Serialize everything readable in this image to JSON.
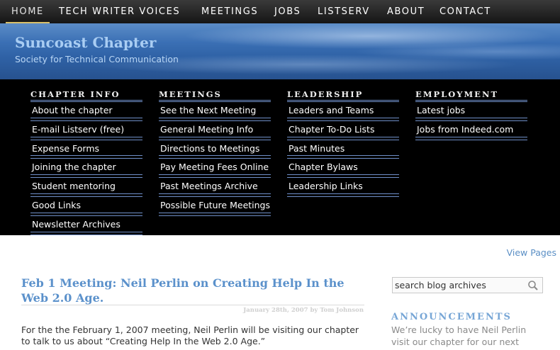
{
  "topnav": {
    "items": [
      "HOME",
      "TECH WRITER VOICES",
      "MEETINGS",
      "JOBS",
      "LISTSERV",
      "ABOUT",
      "CONTACT"
    ]
  },
  "banner": {
    "title": "Suncoast Chapter",
    "subtitle": "Society for Technical Communication"
  },
  "menu": {
    "columns": [
      {
        "heading": "CHAPTER INFO",
        "links": [
          "About the chapter",
          "E-mail Listserv (free)",
          "Expense Forms",
          "Joining the chapter",
          "Student mentoring",
          "Good Links",
          "Newsletter Archives"
        ]
      },
      {
        "heading": "MEETINGS",
        "links": [
          "See the Next Meeting",
          "General Meeting Info",
          "Directions to Meetings",
          "Pay Meeting Fees Online",
          "Past Meetings Archive",
          "Possible Future Meetings"
        ]
      },
      {
        "heading": "LEADERSHIP",
        "links": [
          "Leaders and Teams",
          "Chapter To-Do Lists",
          "Past Minutes",
          "Chapter Bylaws",
          "Leadership Links"
        ]
      },
      {
        "heading": "EMPLOYMENT",
        "links": [
          "Latest jobs",
          "Jobs from Indeed.com"
        ]
      }
    ]
  },
  "content": {
    "view_pages": "View Pages",
    "post": {
      "title": "Feb 1 Meeting: Neil Perlin on Creating Help In the Web 2.0 Age.",
      "meta": "January 28th, 2007 by Tom Johnson",
      "body_lines": [
        "For the the February 1, 2007 meeting, Neil Perlin will be visiting our chapter",
        "to talk to us about “Creating Help In the Web 2.0 Age.”"
      ]
    },
    "sidebar": {
      "search_value": "search blog archives",
      "announcements_heading": "ANNOUNCEMENTS",
      "announcement_lines": [
        "We’re lucky to have Neil Perlin",
        "visit our chapter for our next"
      ]
    }
  },
  "colors": {
    "nav_bg": "#1f1f1f",
    "banner_blue": "#3a6fb4",
    "menu_bg": "#000000",
    "menu_rule": "#6f8fc9",
    "link_blue": "#5b91cb",
    "active_underline": "#d9c06a"
  },
  "icons": {
    "search": "search-icon"
  }
}
